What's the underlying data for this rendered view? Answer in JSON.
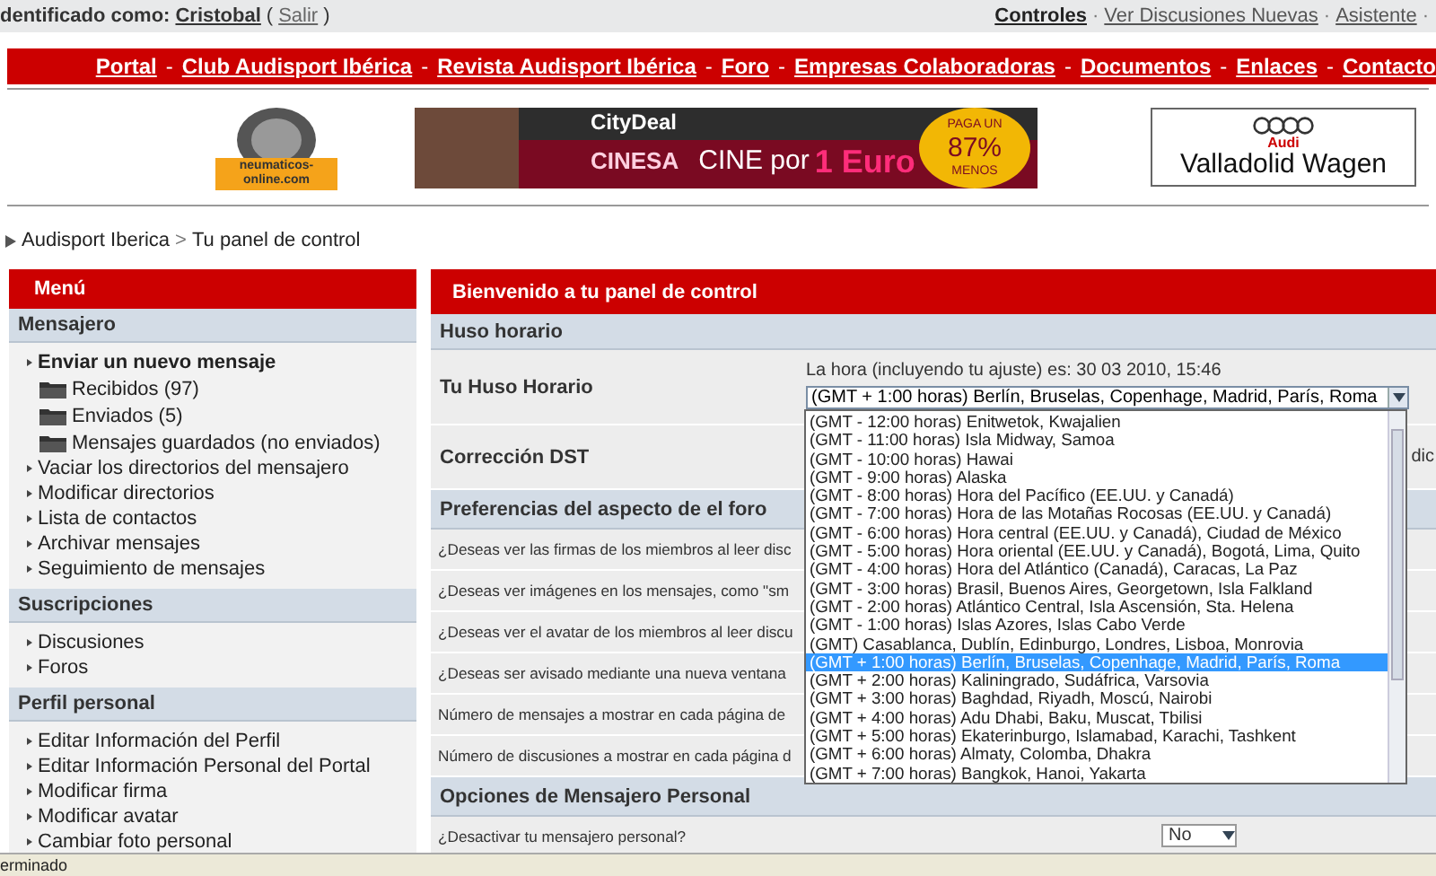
{
  "user_bar": {
    "label": "dentificado como:",
    "user": "Cristobal",
    "logout_open": "(",
    "logout": "Salir",
    "logout_close": ")",
    "separator": "·",
    "links": [
      "Controles",
      "Ver Discusiones Nuevas",
      "Asistente"
    ]
  },
  "nav": {
    "separator": "-",
    "links": [
      "Portal",
      "Club Audisport Ibérica",
      "Revista Audisport Ibérica",
      "Foro",
      "Empresas Colaboradoras",
      "Documentos",
      "Enlaces",
      "Contacto"
    ]
  },
  "ads": {
    "tires": {
      "label": "neumaticos-online.com"
    },
    "cinema": {
      "brand": "CityDeal",
      "cinema": "CINESA",
      "text": "CINE por",
      "price": "1 Euro",
      "badge_top": "PAGA UN",
      "badge_pct": "87%",
      "badge_bottom": "MENOS"
    },
    "dealer": {
      "brand": "Audi",
      "name": "Valladolid Wagen"
    }
  },
  "breadcrumb": {
    "separator": ">",
    "items": [
      "Audisport Iberica",
      "Tu panel de control"
    ]
  },
  "sidebar": {
    "title": "Menú",
    "sections": [
      {
        "title": "Mensajero",
        "items": [
          {
            "label": "Enviar un nuevo mensaje",
            "kind": "bullet",
            "bold": true
          },
          {
            "label": "Recibidos (97)",
            "kind": "folder",
            "bold": false
          },
          {
            "label": "Enviados (5)",
            "kind": "folder",
            "bold": false
          },
          {
            "label": "Mensajes guardados (no enviados)",
            "kind": "folder",
            "bold": false
          },
          {
            "label": "Vaciar los directorios del mensajero",
            "kind": "bullet",
            "bold": false
          },
          {
            "label": "Modificar directorios",
            "kind": "bullet",
            "bold": false
          },
          {
            "label": "Lista de contactos",
            "kind": "bullet",
            "bold": false
          },
          {
            "label": "Archivar mensajes",
            "kind": "bullet",
            "bold": false
          },
          {
            "label": "Seguimiento de mensajes",
            "kind": "bullet",
            "bold": false
          }
        ]
      },
      {
        "title": "Suscripciones",
        "items": [
          {
            "label": "Discusiones",
            "kind": "bullet",
            "bold": false
          },
          {
            "label": "Foros",
            "kind": "bullet",
            "bold": false
          }
        ]
      },
      {
        "title": "Perfil personal",
        "items": [
          {
            "label": "Editar Información del Perfil",
            "kind": "bullet",
            "bold": false
          },
          {
            "label": "Editar Información Personal del Portal",
            "kind": "bullet",
            "bold": false
          },
          {
            "label": "Modificar firma",
            "kind": "bullet",
            "bold": false
          },
          {
            "label": "Modificar avatar",
            "kind": "bullet",
            "bold": false
          },
          {
            "label": "Cambiar foto personal",
            "kind": "bullet",
            "bold": false
          }
        ]
      }
    ]
  },
  "main": {
    "title": "Bienvenido a tu panel de control",
    "sections": [
      {
        "title": "Huso horario",
        "rows": [
          {
            "label": "Tu Huso Horario",
            "kind": "timezone"
          },
          {
            "label": "Corrección DST",
            "kind": "dst",
            "aside": "dic"
          }
        ]
      },
      {
        "title": "Preferencias del aspecto de el foro",
        "rows": [
          {
            "label": "¿Deseas ver las firmas de los miembros al leer disc",
            "kind": "plain"
          },
          {
            "label": "¿Deseas ver imágenes en los mensajes, como \"sm",
            "kind": "plain"
          },
          {
            "label": "¿Deseas ver el avatar de los miembros al leer discu",
            "kind": "plain"
          },
          {
            "label": "¿Deseas ser avisado mediante una nueva ventana",
            "kind": "plain"
          },
          {
            "label": "Número de mensajes a mostrar en cada página de",
            "kind": "plain"
          },
          {
            "label": "Número de discusiones a mostrar en cada página d",
            "kind": "plain"
          }
        ]
      },
      {
        "title": "Opciones de Mensajero Personal",
        "rows": [
          {
            "label": "¿Desactivar tu mensajero personal?",
            "kind": "select",
            "value": "No"
          }
        ]
      }
    ]
  },
  "timezone": {
    "note": "La hora (incluyendo tu ajuste) es: 30 03 2010, 15:46",
    "value": "(GMT + 1:00 horas) Berlín, Bruselas, Copenhage, Madrid, París, Roma",
    "expanded": true,
    "options": [
      {
        "label": "(GMT - 12:00 horas) Enitwetok, Kwajalien",
        "selected": false
      },
      {
        "label": "(GMT - 11:00 horas) Isla Midway, Samoa",
        "selected": false
      },
      {
        "label": "(GMT - 10:00 horas) Hawai",
        "selected": false
      },
      {
        "label": "(GMT - 9:00 horas) Alaska",
        "selected": false
      },
      {
        "label": "(GMT - 8:00 horas) Hora del Pacífico (EE.UU. y Canadá)",
        "selected": false
      },
      {
        "label": "(GMT - 7:00 horas) Hora de las Motañas Rocosas (EE.UU. y Canadá)",
        "selected": false
      },
      {
        "label": "(GMT - 6:00 horas) Hora central (EE.UU. y Canadá), Ciudad de México",
        "selected": false
      },
      {
        "label": "(GMT - 5:00 horas) Hora oriental (EE.UU. y Canadá), Bogotá, Lima, Quito",
        "selected": false
      },
      {
        "label": "(GMT - 4:00 horas) Hora del Atlántico (Canadá), Caracas, La Paz",
        "selected": false
      },
      {
        "label": "(GMT - 3:00 horas) Brasil, Buenos Aires, Georgetown, Isla Falkland",
        "selected": false
      },
      {
        "label": "(GMT - 2:00 horas) Atlántico Central, Isla Ascensión, Sta. Helena",
        "selected": false
      },
      {
        "label": "(GMT - 1:00 horas) Islas Azores, Islas Cabo Verde",
        "selected": false
      },
      {
        "label": "(GMT) Casablanca, Dublín, Edinburgo, Londres, Lisboa, Monrovia",
        "selected": false
      },
      {
        "label": "(GMT + 1:00 horas) Berlín, Bruselas, Copenhage, Madrid, París, Roma",
        "selected": true
      },
      {
        "label": "(GMT + 2:00 horas) Kaliningrado, Sudáfrica, Varsovia",
        "selected": false
      },
      {
        "label": "(GMT + 3:00 horas) Baghdad, Riyadh, Moscú, Nairobi",
        "selected": false
      },
      {
        "label": "(GMT + 4:00 horas) Adu Dhabi, Baku, Muscat, Tbilisi",
        "selected": false
      },
      {
        "label": "(GMT + 5:00 horas) Ekaterinburgo, Islamabad, Karachi, Tashkent",
        "selected": false
      },
      {
        "label": "(GMT + 6:00 horas) Almaty, Colomba, Dhakra",
        "selected": false
      },
      {
        "label": "(GMT + 7:00 horas) Bangkok, Hanoi, Yakarta",
        "selected": false
      }
    ]
  },
  "status_bar": {
    "text": "erminado"
  }
}
